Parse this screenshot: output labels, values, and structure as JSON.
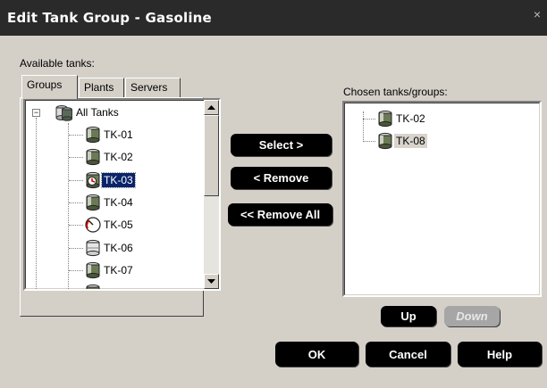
{
  "window": {
    "title": "Edit Tank Group - Gasoline",
    "close_glyph": "×"
  },
  "available_label": "Available tanks:",
  "tabs": [
    {
      "label": "Groups",
      "active": true
    },
    {
      "label": "Plants",
      "active": false
    },
    {
      "label": "Servers",
      "active": false
    }
  ],
  "available_tree": {
    "root": {
      "label": "All Tanks",
      "expander": "−",
      "icon": "tank-group-icon"
    },
    "items": [
      {
        "label": "TK-01",
        "icon": "tank-icon"
      },
      {
        "label": "TK-02",
        "icon": "tank-icon"
      },
      {
        "label": "TK-03",
        "icon": "tank-alert-icon",
        "selected": true
      },
      {
        "label": "TK-04",
        "icon": "tank-icon"
      },
      {
        "label": "TK-05",
        "icon": "tank-gauge-icon"
      },
      {
        "label": "TK-06",
        "icon": "tank-empty-icon"
      },
      {
        "label": "TK-07",
        "icon": "tank-icon"
      }
    ]
  },
  "middle_buttons": {
    "select": {
      "label": "Select >"
    },
    "remove": {
      "label": "< Remove"
    },
    "remove_all": {
      "label": "<< Remove All"
    }
  },
  "chosen_label": "Chosen tanks/groups:",
  "chosen_list": [
    {
      "label": "TK-02",
      "icon": "tank-icon"
    },
    {
      "label": "TK-08",
      "icon": "tank-icon",
      "highlighted": true
    }
  ],
  "order_buttons": {
    "up": {
      "label": "Up",
      "enabled": true
    },
    "down": {
      "label": "Down",
      "enabled": false
    }
  },
  "footer_buttons": {
    "ok": {
      "label": "OK"
    },
    "cancel": {
      "label": "Cancel"
    },
    "help": {
      "label": "Help"
    }
  }
}
